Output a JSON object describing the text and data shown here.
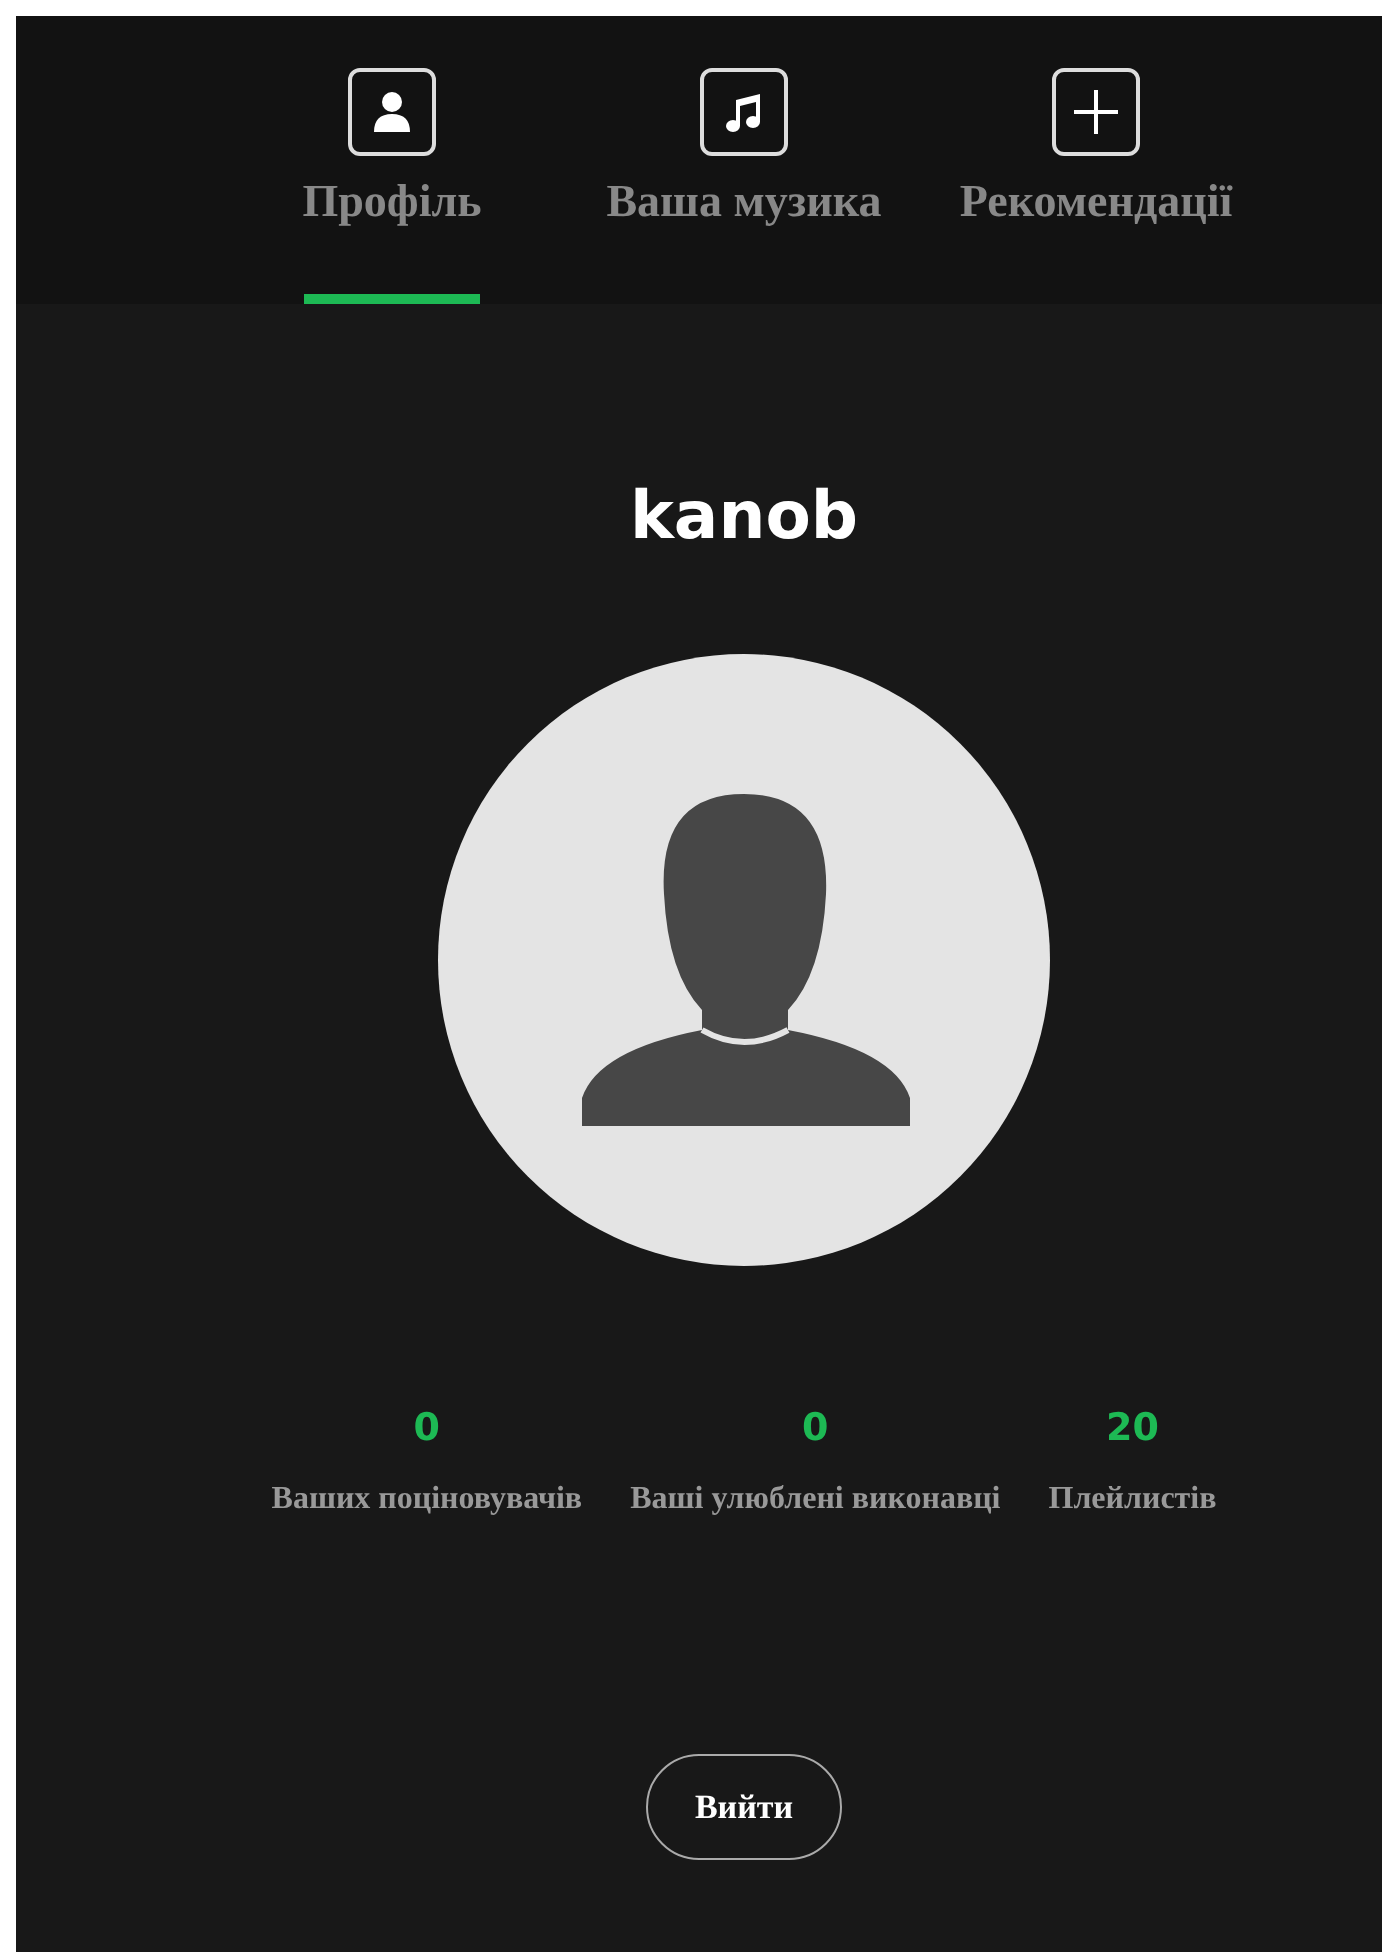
{
  "tabs": [
    {
      "label": "Профіль",
      "kind": "person",
      "selected": true
    },
    {
      "label": "Ваша музика",
      "kind": "music",
      "selected": false
    },
    {
      "label": "Рекомендації",
      "kind": "plus",
      "selected": false
    }
  ],
  "profile": {
    "username": "kanob"
  },
  "stats": [
    {
      "value": "0",
      "label": "Ваших поціновувачів"
    },
    {
      "value": "0",
      "label": "Ваші улюблені виконавці"
    },
    {
      "value": "20",
      "label": "Плейлистів"
    }
  ],
  "logout_button": "Вийти"
}
